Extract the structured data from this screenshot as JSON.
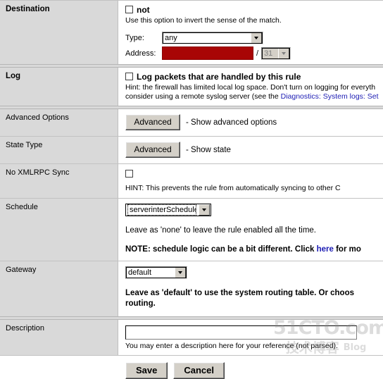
{
  "watermark": {
    "top": "51CTO.com",
    "bottom_cn": "技术博客",
    "bottom_en": "Blog"
  },
  "rows": {
    "destination": {
      "label": "Destination",
      "not_checkbox_label": "not",
      "not_hint": "Use this option to invert the sense of the match.",
      "type_label": "Type:",
      "type_value": "any",
      "address_label": "Address:",
      "address_value": "",
      "slash": "/",
      "mask_value": "31"
    },
    "log": {
      "label": "Log",
      "checkbox_label": "Log packets that are handled by this rule",
      "hint_line1": "Hint: the firewall has limited local log space. Don't turn on logging for everyth",
      "hint_line2_pre": "consider using a remote syslog server (see the ",
      "hint_line2_link": "Diagnostics: System logs: Set"
    },
    "advanced_options": {
      "label": "Advanced Options",
      "button_label": "Advanced",
      "after_text": "- Show advanced options"
    },
    "state_type": {
      "label": "State Type",
      "button_label": "Advanced",
      "after_text": "- Show state"
    },
    "no_xmlrpc_sync": {
      "label": "No XMLRPC Sync",
      "hint": "HINT: This prevents the rule from automatically syncing to other C"
    },
    "schedule": {
      "label": "Schedule",
      "select_value": "serverinterSchedule",
      "hint": "Leave as 'none' to leave the rule enabled all the time.",
      "note_pre": "NOTE: schedule logic can be a bit different. Click ",
      "note_link": "here",
      "note_post": " for mo"
    },
    "gateway": {
      "label": "Gateway",
      "select_value": "default",
      "note_line1": "Leave as 'default' to use the system routing table. Or choos",
      "note_line2": "routing."
    },
    "description": {
      "label": "Description",
      "input_value": "",
      "hint": "You may enter a description here for your reference (not parsed)."
    }
  },
  "footer": {
    "save_label": "Save",
    "cancel_label": "Cancel"
  },
  "colors": {
    "label_bg": "#d9d9d9",
    "address_field": "#a80505",
    "link": "#1b1bb3",
    "button_face": "#d4d0c8"
  }
}
